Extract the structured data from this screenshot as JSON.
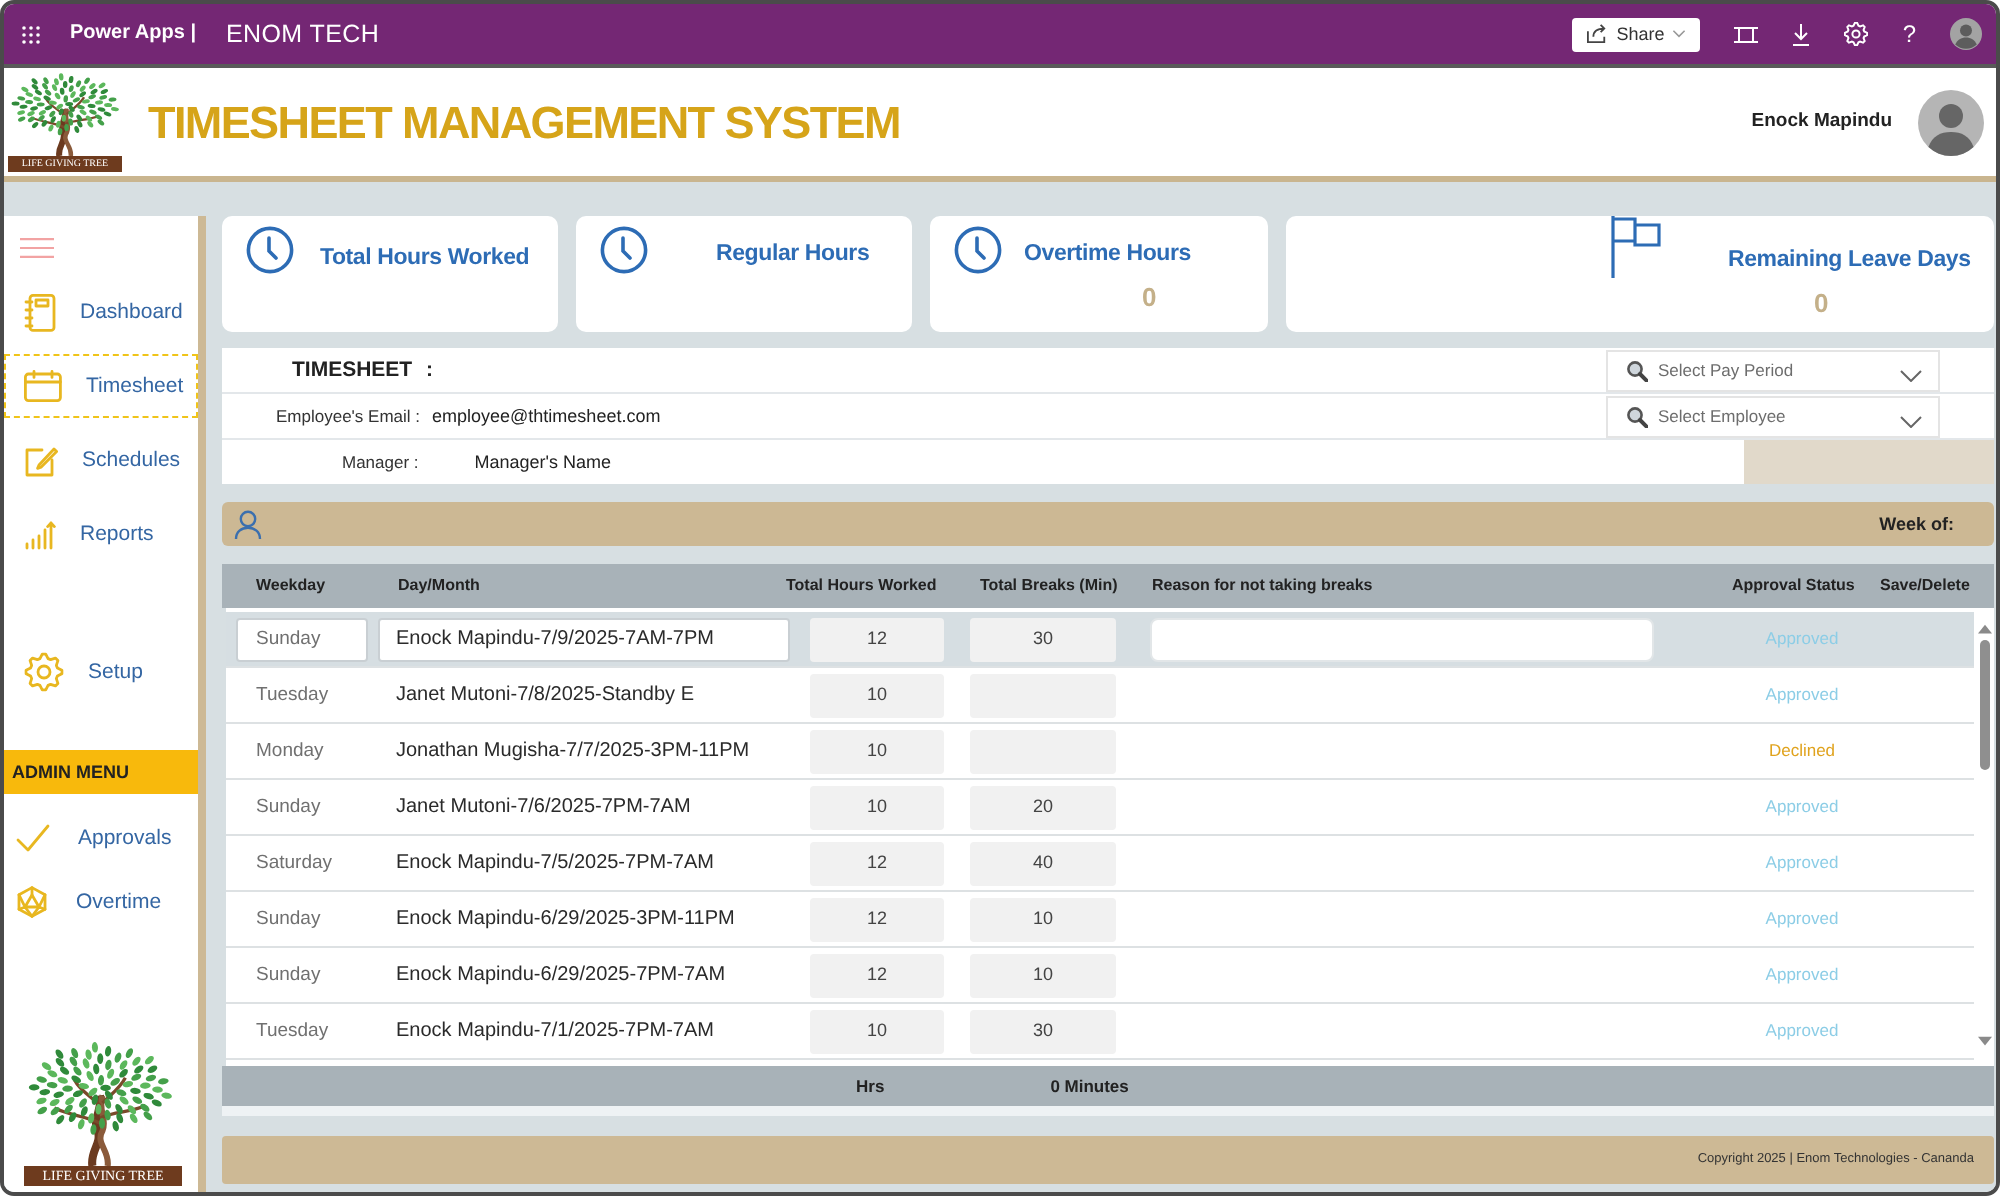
{
  "top_bar": {
    "app_name": "Power Apps |",
    "environment": "ENOM TECH",
    "share_button": "Share",
    "help_button": "?"
  },
  "header": {
    "logo_caption": "LIFE GIVING TREE",
    "title": "TIMESHEET MANAGEMENT SYSTEM",
    "user_name": "Enock Mapindu"
  },
  "sidebar": {
    "main_items": [
      {
        "label": "Dashboard",
        "selected": false
      },
      {
        "label": "Timesheet",
        "selected": true
      },
      {
        "label": "Schedules",
        "selected": false
      },
      {
        "label": "Reports",
        "selected": false
      }
    ],
    "setup_items": [
      {
        "label": "Setup",
        "selected": false
      }
    ],
    "admin_heading": "ADMIN MENU",
    "admin_items": [
      {
        "label": "Approvals",
        "selected": false
      },
      {
        "label": "Overtime",
        "selected": false
      }
    ],
    "logo_caption": "LIFE GIVING TREE"
  },
  "cards": [
    {
      "title": "Total Hours Worked"
    },
    {
      "title": "Regular Hours"
    },
    {
      "title": "Overtime Hours",
      "value": "0"
    },
    {
      "title": "Remaining Leave Days",
      "value": "0"
    }
  ],
  "timesheet_form": {
    "heading": "TIMESHEET :",
    "email_label": "Employee's Email :",
    "email": "employee@thtimesheet.com",
    "manager_label": "Manager :",
    "manager": "Manager's Name",
    "pay_period": {
      "placeholder": "Select Pay Period"
    },
    "employee": {
      "placeholder": "Select Employee"
    }
  },
  "week_bar": {
    "label": "Week of:"
  },
  "table": {
    "columns": [
      "Weekday",
      "Day/Month",
      "Total Hours Worked",
      "Total Breaks (Min)",
      "Reason for not taking breaks",
      "Approval Status",
      "Save/Delete"
    ],
    "rows": [
      {
        "weekday": "Sunday",
        "day_month": "Enock Mapindu-7/9/2025-7AM-7PM",
        "hours": "12",
        "breaks": "30",
        "approval_status": "Approved",
        "color": "#8ccde6",
        "selected": true
      },
      {
        "weekday": "Tuesday",
        "day_month": "Janet Mutoni-7/8/2025-Standby E",
        "hours": "10",
        "approval_status": "Approved",
        "color": "#8ccde6",
        "selected": false
      },
      {
        "weekday": "Monday",
        "day_month": "Jonathan Mugisha-7/7/2025-3PM-11PM",
        "hours": "10",
        "approval_status": "Declined",
        "color": "#e0a31e",
        "selected": false
      },
      {
        "weekday": "Sunday",
        "day_month": "Janet Mutoni-7/6/2025-7PM-7AM",
        "hours": "10",
        "breaks": "20",
        "approval_status": "Approved",
        "color": "#8ccde6",
        "selected": false
      },
      {
        "weekday": "Saturday",
        "day_month": "Enock Mapindu-7/5/2025-7PM-7AM",
        "hours": "12",
        "breaks": "40",
        "approval_status": "Approved",
        "color": "#8ccde6",
        "selected": false
      },
      {
        "weekday": "Sunday",
        "day_month": "Enock Mapindu-6/29/2025-3PM-11PM",
        "hours": "12",
        "breaks": "10",
        "approval_status": "Approved",
        "color": "#8ccde6",
        "selected": false
      },
      {
        "weekday": "Sunday",
        "day_month": "Enock Mapindu-6/29/2025-7PM-7AM",
        "hours": "12",
        "breaks": "10",
        "approval_status": "Approved",
        "color": "#8ccde6",
        "selected": false
      },
      {
        "weekday": "Tuesday",
        "day_month": "Enock Mapindu-7/1/2025-7PM-7AM",
        "hours": "10",
        "breaks": "30",
        "approval_status": "Approved",
        "color": "#8ccde6",
        "selected": false
      }
    ]
  },
  "totals": {
    "hours": "Hrs",
    "breaks": "0 Minutes"
  },
  "footer": {
    "copyright": "Copyright 2025 | Enom Technologies - Cananda"
  }
}
